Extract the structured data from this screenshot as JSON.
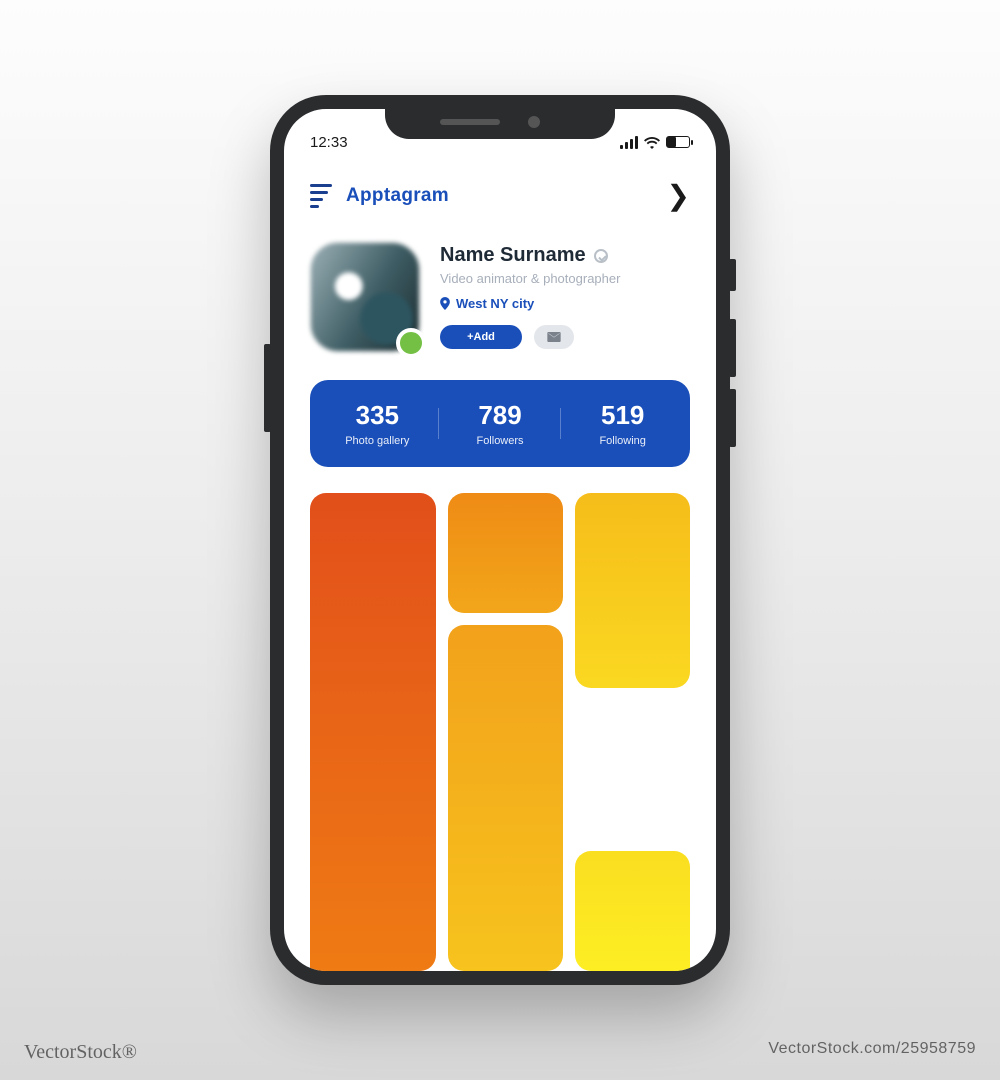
{
  "status": {
    "time": "12:33"
  },
  "app": {
    "title": "Apptagram"
  },
  "profile": {
    "name": "Name Surname",
    "subtitle": "Video animator & photographer",
    "location": "West NY city",
    "add_label": "+Add"
  },
  "stats": [
    {
      "value": "335",
      "label": "Photo gallery"
    },
    {
      "value": "789",
      "label": "Followers"
    },
    {
      "value": "519",
      "label": "Following"
    }
  ],
  "watermark": {
    "left": "VectorStock®",
    "right": "VectorStock.com/25958759"
  },
  "colors": {
    "brand_blue": "#1a4fba",
    "presence_green": "#74c044",
    "tile_from": "#e24f1a",
    "tile_to": "#fdee24"
  }
}
